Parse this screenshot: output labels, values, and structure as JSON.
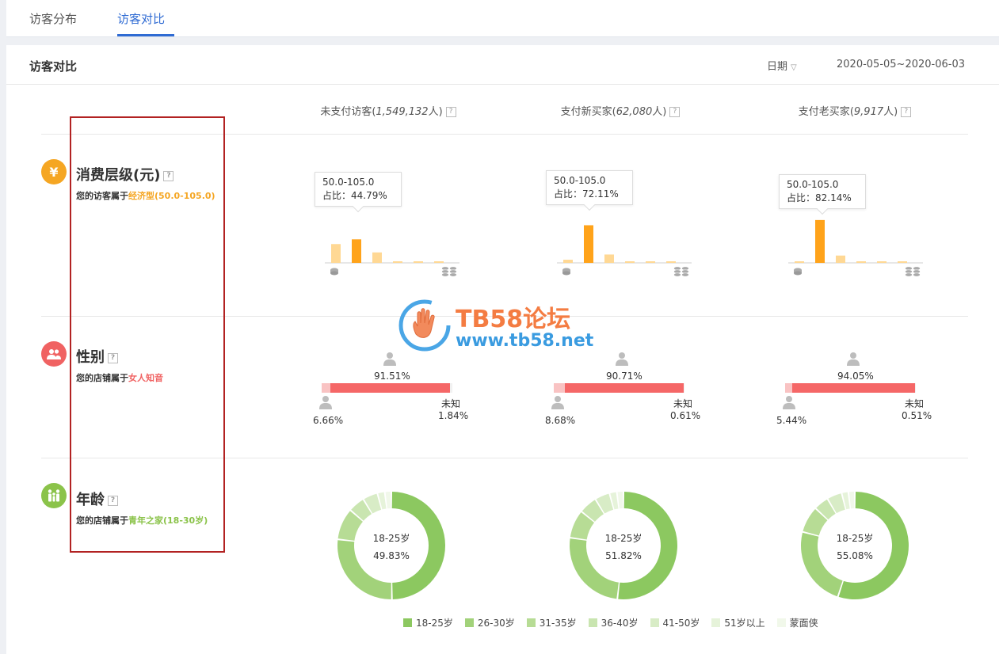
{
  "tabs": [
    {
      "label": "访客分布",
      "active": false
    },
    {
      "label": "访客对比",
      "active": true
    }
  ],
  "panel": {
    "title": "访客对比",
    "date_label": "日期",
    "date_range": "2020-05-05~2020-06-03"
  },
  "columns": [
    {
      "name": "未支付访客",
      "count": "1,549,132",
      "unit": "人"
    },
    {
      "name": "支付新买家",
      "count": "62,080",
      "unit": "人"
    },
    {
      "name": "支付老买家",
      "count": "9,917",
      "unit": "人"
    }
  ],
  "help_glyph": "?",
  "sections": {
    "spend": {
      "title": "消费层级(元)",
      "desc_prefix": "您的访客属于",
      "desc_value": "经济型(50.0-105.0)",
      "color": "#f5a623",
      "icon": "yen-icon",
      "icon_glyph": "¥"
    },
    "gender": {
      "title": "性别",
      "desc_prefix": "您的店铺属于",
      "desc_value": "女人知音",
      "color": "#f06262",
      "icon": "people-icon"
    },
    "age": {
      "title": "年龄",
      "desc_prefix": "您的店铺属于",
      "desc_value": "青年之家(18-30岁)",
      "color": "#8bc34a",
      "icon": "family-icon"
    }
  },
  "spend_charts": [
    {
      "tooltip_range": "50.0-105.0",
      "tooltip_share": "占比：44.79%",
      "values": [
        0.36,
        0.45,
        0.2,
        0.03,
        0.01,
        0.01
      ],
      "highlight": 1
    },
    {
      "tooltip_range": "50.0-105.0",
      "tooltip_share": "占比：72.11%",
      "values": [
        0.06,
        0.72,
        0.16,
        0.02,
        0.01,
        0.01
      ],
      "highlight": 1
    },
    {
      "tooltip_range": "50.0-105.0",
      "tooltip_share": "占比：82.14%",
      "values": [
        0.02,
        0.82,
        0.14,
        0.01,
        0.005,
        0.005
      ],
      "highlight": 1
    }
  ],
  "gender_charts": [
    {
      "female": "91.51%",
      "male": "6.66%",
      "unknown_label": "未知",
      "unknown": "1.84%",
      "female_v": 91.51,
      "male_v": 6.66,
      "unknown_v": 1.84
    },
    {
      "female": "90.71%",
      "male": "8.68%",
      "unknown_label": "未知",
      "unknown": "0.61%",
      "female_v": 90.71,
      "male_v": 8.68,
      "unknown_v": 0.61
    },
    {
      "female": "94.05%",
      "male": "5.44%",
      "unknown_label": "未知",
      "unknown": "0.51%",
      "female_v": 94.05,
      "male_v": 5.44,
      "unknown_v": 0.51
    }
  ],
  "age_charts": [
    {
      "center_label": "18-25岁",
      "center_value": "49.83%",
      "values": [
        49.83,
        27.0,
        9.5,
        5.0,
        4.5,
        2.2,
        1.97
      ]
    },
    {
      "center_label": "18-25岁",
      "center_value": "51.82%",
      "values": [
        51.82,
        25.5,
        8.5,
        5.5,
        4.5,
        2.2,
        1.98
      ]
    },
    {
      "center_label": "18-25岁",
      "center_value": "55.08%",
      "values": [
        55.08,
        24.0,
        8.0,
        4.5,
        4.5,
        2.0,
        1.92
      ]
    }
  ],
  "age_legend": [
    {
      "label": "18-25岁",
      "color": "#8cc860"
    },
    {
      "label": "26-30岁",
      "color": "#a2d27a"
    },
    {
      "label": "31-35岁",
      "color": "#b7dc95"
    },
    {
      "label": "36-40岁",
      "color": "#c9e5b0"
    },
    {
      "label": "41-50岁",
      "color": "#d8ecc6"
    },
    {
      "label": "51岁以上",
      "color": "#e6f3da"
    },
    {
      "label": "蒙面侠",
      "color": "#f1f8ea"
    }
  ],
  "spend_colors": {
    "highlight": "#ffa31a",
    "normal": "#ffd894"
  },
  "gender_colors": {
    "female": "#f56767",
    "male": "#f9c3c3",
    "unknown": "#f1f1f1"
  },
  "watermark": {
    "title": "TB58论坛",
    "url": "www.tb58.net"
  }
}
